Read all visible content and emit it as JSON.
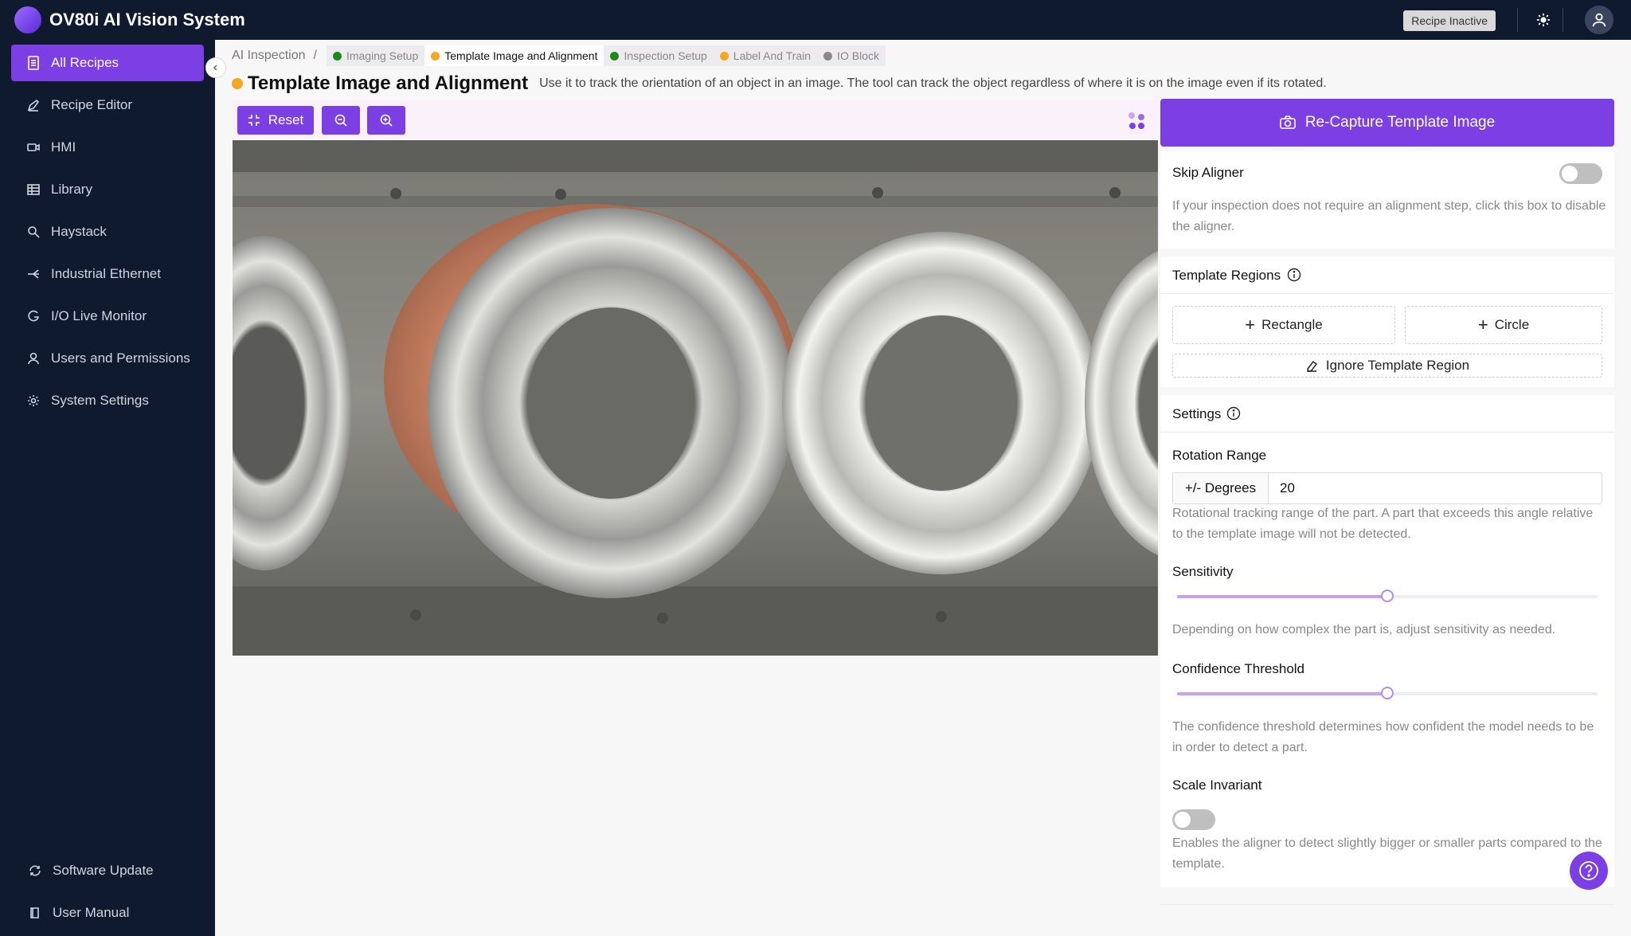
{
  "app": {
    "title": "OV80i AI Vision System",
    "recipe_status": "Recipe Inactive"
  },
  "sidebar": {
    "items": [
      {
        "label": "All Recipes",
        "icon": "document-icon"
      },
      {
        "label": "Recipe Editor",
        "icon": "pencil-icon"
      },
      {
        "label": "HMI",
        "icon": "video-icon"
      },
      {
        "label": "Library",
        "icon": "grid-icon"
      },
      {
        "label": "Haystack",
        "icon": "search-icon"
      },
      {
        "label": "Industrial Ethernet",
        "icon": "network-icon"
      },
      {
        "label": "I/O Live Monitor",
        "icon": "monitor-icon"
      },
      {
        "label": "Users and Permissions",
        "icon": "user-icon"
      },
      {
        "label": "System Settings",
        "icon": "gear-icon"
      }
    ],
    "bottom_items": [
      {
        "label": "Software Update",
        "icon": "refresh-icon"
      },
      {
        "label": "User Manual",
        "icon": "book-icon"
      }
    ]
  },
  "breadcrumb": {
    "root": "AI Inspection",
    "separator": "/",
    "tabs": [
      {
        "label": "Imaging Setup",
        "color": "#1a8a1a"
      },
      {
        "label": "Template Image and Alignment",
        "color": "#f5a623"
      },
      {
        "label": "Inspection Setup",
        "color": "#1a8a1a"
      },
      {
        "label": "Label And Train",
        "color": "#f5a623"
      },
      {
        "label": "IO Block",
        "color": "#8a8a8a"
      }
    ]
  },
  "page": {
    "title": "Template Image and Alignment",
    "description": "Use it to track the orientation of an object in an image. The tool can track the object regardless of where it is on the image even if its rotated."
  },
  "toolbar": {
    "reset_label": "Reset"
  },
  "right": {
    "recapture_label": "Re-Capture Template Image",
    "skip_aligner": {
      "label": "Skip Aligner",
      "help": "If your inspection does not require an alignment step, click this box to disable the aligner.",
      "enabled": false
    },
    "template_regions": {
      "label": "Template Regions",
      "rectangle_label": "Rectangle",
      "circle_label": "Circle",
      "ignore_label": "Ignore Template Region"
    },
    "settings": {
      "label": "Settings",
      "rotation_range": {
        "label": "Rotation Range",
        "unit_label": "+/- Degrees",
        "value": "20",
        "help": "Rotational tracking range of the part. A part that exceeds this angle relative to the template image will not be detected."
      },
      "sensitivity": {
        "label": "Sensitivity",
        "value": 0.5,
        "help": "Depending on how complex the part is, adjust sensitivity as needed."
      },
      "confidence": {
        "label": "Confidence Threshold",
        "value": 0.5,
        "help": "The confidence threshold determines how confident the model needs to be in order to detect a part."
      },
      "scale_invariant": {
        "label": "Scale Invariant",
        "help": "Enables the aligner to detect slightly bigger or smaller parts compared to the template.",
        "enabled": false
      }
    }
  },
  "colors": {
    "accent": "#7b3fe4",
    "nav_bg": "#0f1a2e"
  }
}
